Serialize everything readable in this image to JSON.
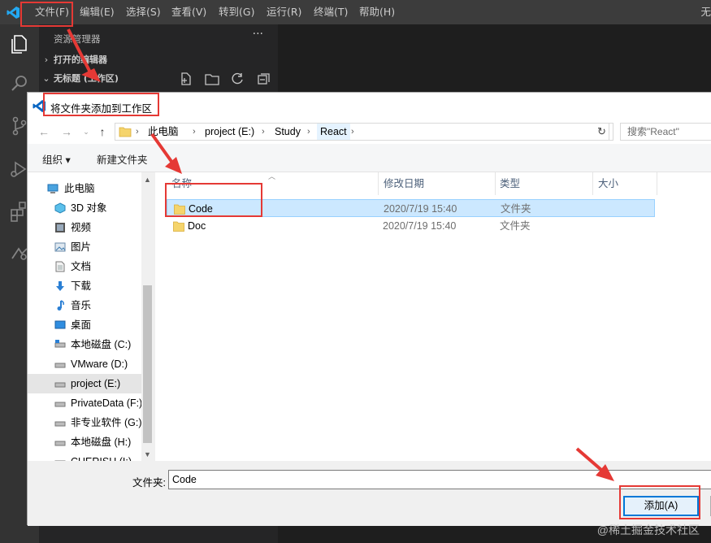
{
  "vscode": {
    "menus": [
      "文件(F)",
      "编辑(E)",
      "选择(S)",
      "查看(V)",
      "转到(G)",
      "运行(R)",
      "终端(T)",
      "帮助(H)"
    ],
    "title_right": "无",
    "explorer_title": "资源管理器",
    "more": "···",
    "section_open_editors": "打开的编辑器",
    "section_workspace": "无标题 (工作区)",
    "activity_icons": [
      "explorer-icon",
      "search-icon",
      "source-control-icon",
      "run-debug-icon",
      "extensions-icon",
      "remote-icon"
    ]
  },
  "dialog": {
    "title": "将文件夹添加到工作区",
    "breadcrumb": [
      "此电脑",
      "project (E:)",
      "Study",
      "React"
    ],
    "search_placeholder": "搜索\"React\"",
    "toolbar": {
      "organize": "组织 ▾",
      "new_folder": "新建文件夹"
    },
    "nav_items": [
      {
        "label": "此电脑",
        "icon": "computer-icon"
      },
      {
        "label": "3D 对象",
        "icon": "3d-objects-icon"
      },
      {
        "label": "视频",
        "icon": "video-icon"
      },
      {
        "label": "图片",
        "icon": "pictures-icon"
      },
      {
        "label": "文档",
        "icon": "documents-icon"
      },
      {
        "label": "下载",
        "icon": "download-icon"
      },
      {
        "label": "音乐",
        "icon": "music-icon"
      },
      {
        "label": "桌面",
        "icon": "desktop-icon"
      },
      {
        "label": "本地磁盘 (C:)",
        "icon": "drive-icon"
      },
      {
        "label": "VMware (D:)",
        "icon": "drive-icon"
      },
      {
        "label": "project (E:)",
        "icon": "drive-icon"
      },
      {
        "label": "PrivateData (F:)",
        "icon": "drive-icon"
      },
      {
        "label": "非专业软件 (G:)",
        "icon": "drive-icon"
      },
      {
        "label": "本地磁盘 (H:)",
        "icon": "drive-icon"
      },
      {
        "label": "CHERISH (I:)",
        "icon": "drive-icon"
      }
    ],
    "columns": [
      "名称",
      "修改日期",
      "类型",
      "大小"
    ],
    "files": [
      {
        "name": "Code",
        "date": "2020/7/19 15:40",
        "type": "文件夹"
      },
      {
        "name": "Doc",
        "date": "2020/7/19 15:40",
        "type": "文件夹"
      }
    ],
    "folder_label": "文件夹:",
    "folder_value": "Code",
    "add_button": "添加(A)"
  },
  "watermark": "@稀土掘金技术社区",
  "colors": {
    "annotation": "#e53935",
    "selection": "#cce8ff",
    "vscode_blue": "#23a9f2"
  }
}
